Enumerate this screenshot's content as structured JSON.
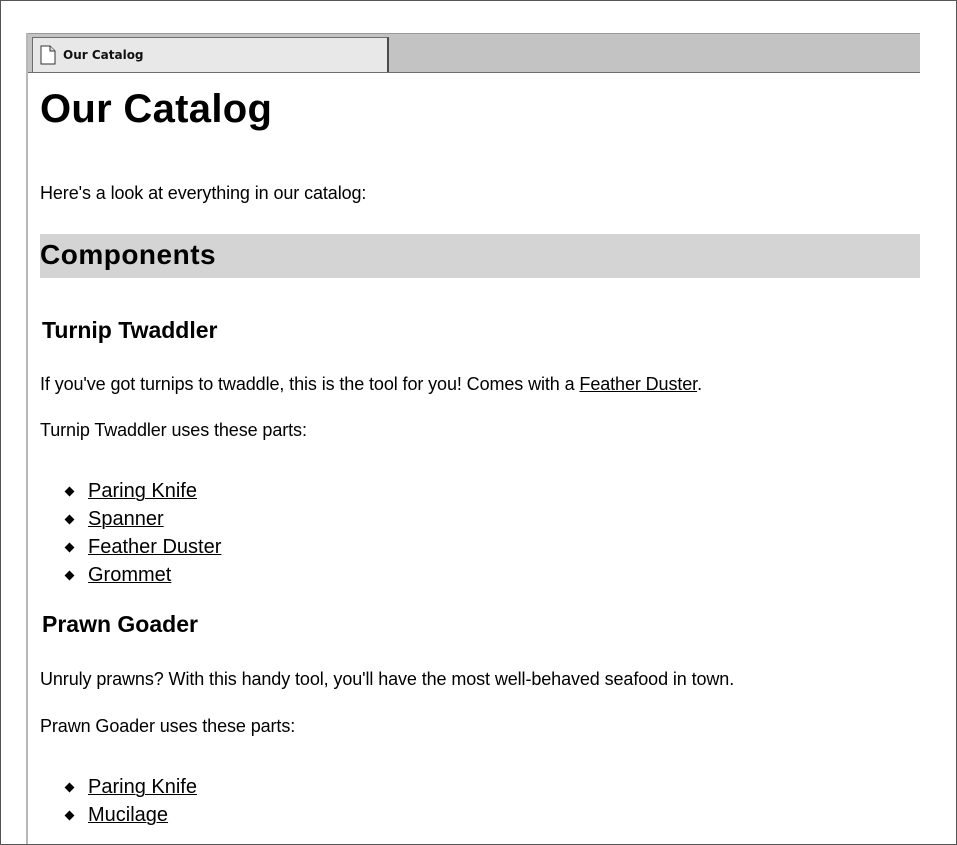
{
  "tab": {
    "title": "Our Catalog",
    "icon": "document-icon"
  },
  "page": {
    "title": "Our Catalog",
    "intro": "Here's a look at everything in our catalog:",
    "section": "Components"
  },
  "products": [
    {
      "name": "Turnip Twaddler",
      "desc_before": "If you've got turnips to twaddle, this is the tool for you! Comes with a ",
      "desc_link": "Feather Duster",
      "desc_after": ".",
      "parts_label": "Turnip Twaddler uses these parts:",
      "parts": [
        "Paring Knife",
        "Spanner",
        "Feather Duster",
        "Grommet"
      ]
    },
    {
      "name": "Prawn Goader",
      "desc": "Unruly prawns? With this handy tool, you'll have the most well-behaved seafood in town.",
      "parts_label": "Prawn Goader uses these parts:",
      "parts": [
        "Paring Knife",
        "Mucilage"
      ]
    }
  ]
}
